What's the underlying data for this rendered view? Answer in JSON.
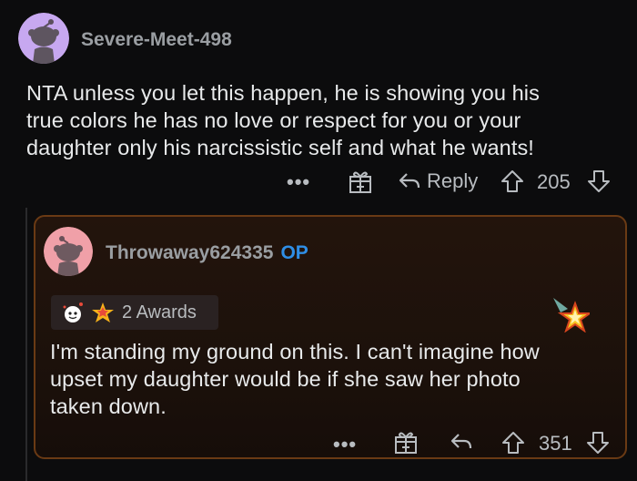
{
  "comment": {
    "username": "Severe-Meet-498",
    "text_lines": [
      "NTA unless you let this happen, he is showing you his",
      "true colors he has no love or respect for you or your",
      "daughter only his narcissistic self and what he wants!"
    ],
    "actions": {
      "more": "•••",
      "reply": "Reply",
      "score": "205"
    }
  },
  "reply": {
    "username": "Throwaway624335",
    "op_badge": "OP",
    "awards_label": "2 Awards",
    "text_lines": [
      "I'm standing my ground on this. I can't imagine how",
      "upset my daughter would be if she saw her photo",
      "taken down."
    ],
    "actions": {
      "more": "•••",
      "score": "351"
    }
  },
  "colors": {
    "background": "#0c0c0d",
    "op_blue": "#2f8ee6",
    "card_border": "#6a3a14",
    "avatar_purple": "#c7a8f0",
    "avatar_pink": "#f0a0a8"
  }
}
